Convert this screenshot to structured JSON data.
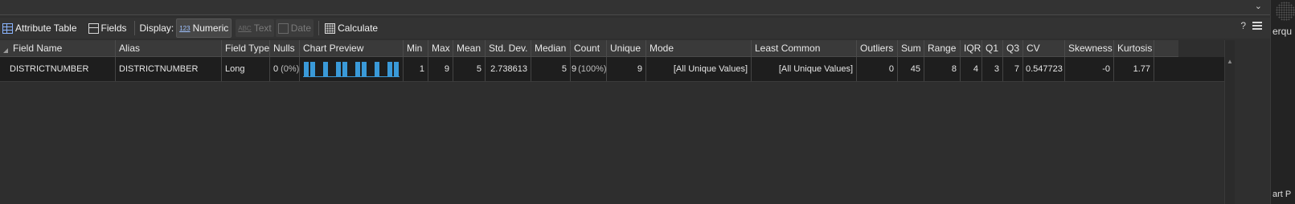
{
  "toolbar": {
    "attribute_table": "Attribute Table",
    "fields": "Fields",
    "display_label": "Display:",
    "numeric": "Numeric",
    "numeric_glyph": "123",
    "text": "Text",
    "text_glyph": "ABC",
    "date": "Date",
    "calculate": "Calculate",
    "help": "?"
  },
  "columns": {
    "field_name": "Field Name",
    "alias": "Alias",
    "field_type": "Field Type",
    "nulls": "Nulls",
    "chart_preview": "Chart Preview",
    "min": "Min",
    "max": "Max",
    "mean": "Mean",
    "std_dev": "Std. Dev.",
    "median": "Median",
    "count": "Count",
    "unique": "Unique",
    "mode": "Mode",
    "least_common": "Least Common",
    "outliers": "Outliers",
    "sum": "Sum",
    "range": "Range",
    "iqr": "IQR",
    "q1": "Q1",
    "q3": "Q3",
    "cv": "CV",
    "skewness": "Skewness",
    "kurtosis": "Kurtosis"
  },
  "row": {
    "field_name": "DISTRICTNUMBER",
    "alias": "DISTRICTNUMBER",
    "field_type": "Long",
    "nulls": "0",
    "nulls_pct": "(0%)",
    "min": "1",
    "max": "9",
    "mean": "5",
    "std_dev": "2.738613",
    "median": "5",
    "count": "9",
    "count_pct": "(100%)",
    "unique": "9",
    "mode": "[All Unique Values]",
    "least_common": "[All Unique Values]",
    "outliers": "0",
    "sum": "45",
    "range": "8",
    "iqr": "4",
    "q1": "3",
    "q3": "7",
    "cv": "0.547723",
    "skewness": "-0",
    "kurtosis": "1.77"
  },
  "chart_preview": {
    "type": "bar",
    "color": "#3a9ad9",
    "values": [
      1,
      1,
      0,
      1,
      0,
      1,
      1,
      0,
      1,
      1,
      0,
      1,
      0,
      1,
      1
    ]
  },
  "right_panel": {
    "text_top": "erqu",
    "text_bottom": "art P"
  },
  "colors": {
    "accent": "#3a9ad9",
    "background": "#2f2f2f",
    "row_background": "#1e1e1e"
  }
}
